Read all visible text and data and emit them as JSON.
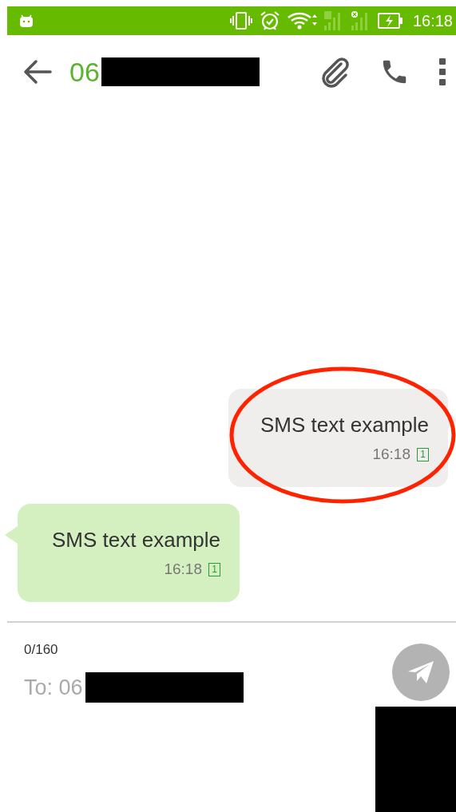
{
  "status_bar": {
    "time": "16:18"
  },
  "header": {
    "title": "06",
    "title_redacted": true
  },
  "messages": [
    {
      "kind": "outgoing",
      "text": "SMS text example",
      "time": "16:18",
      "sim": "1",
      "highlighted": true
    },
    {
      "kind": "incoming",
      "text": "SMS text example",
      "time": "16:18",
      "sim": "1",
      "highlighted": false
    }
  ],
  "composer": {
    "counter": "0/160",
    "recipient": "To: 06",
    "recipient_redacted": true
  }
}
